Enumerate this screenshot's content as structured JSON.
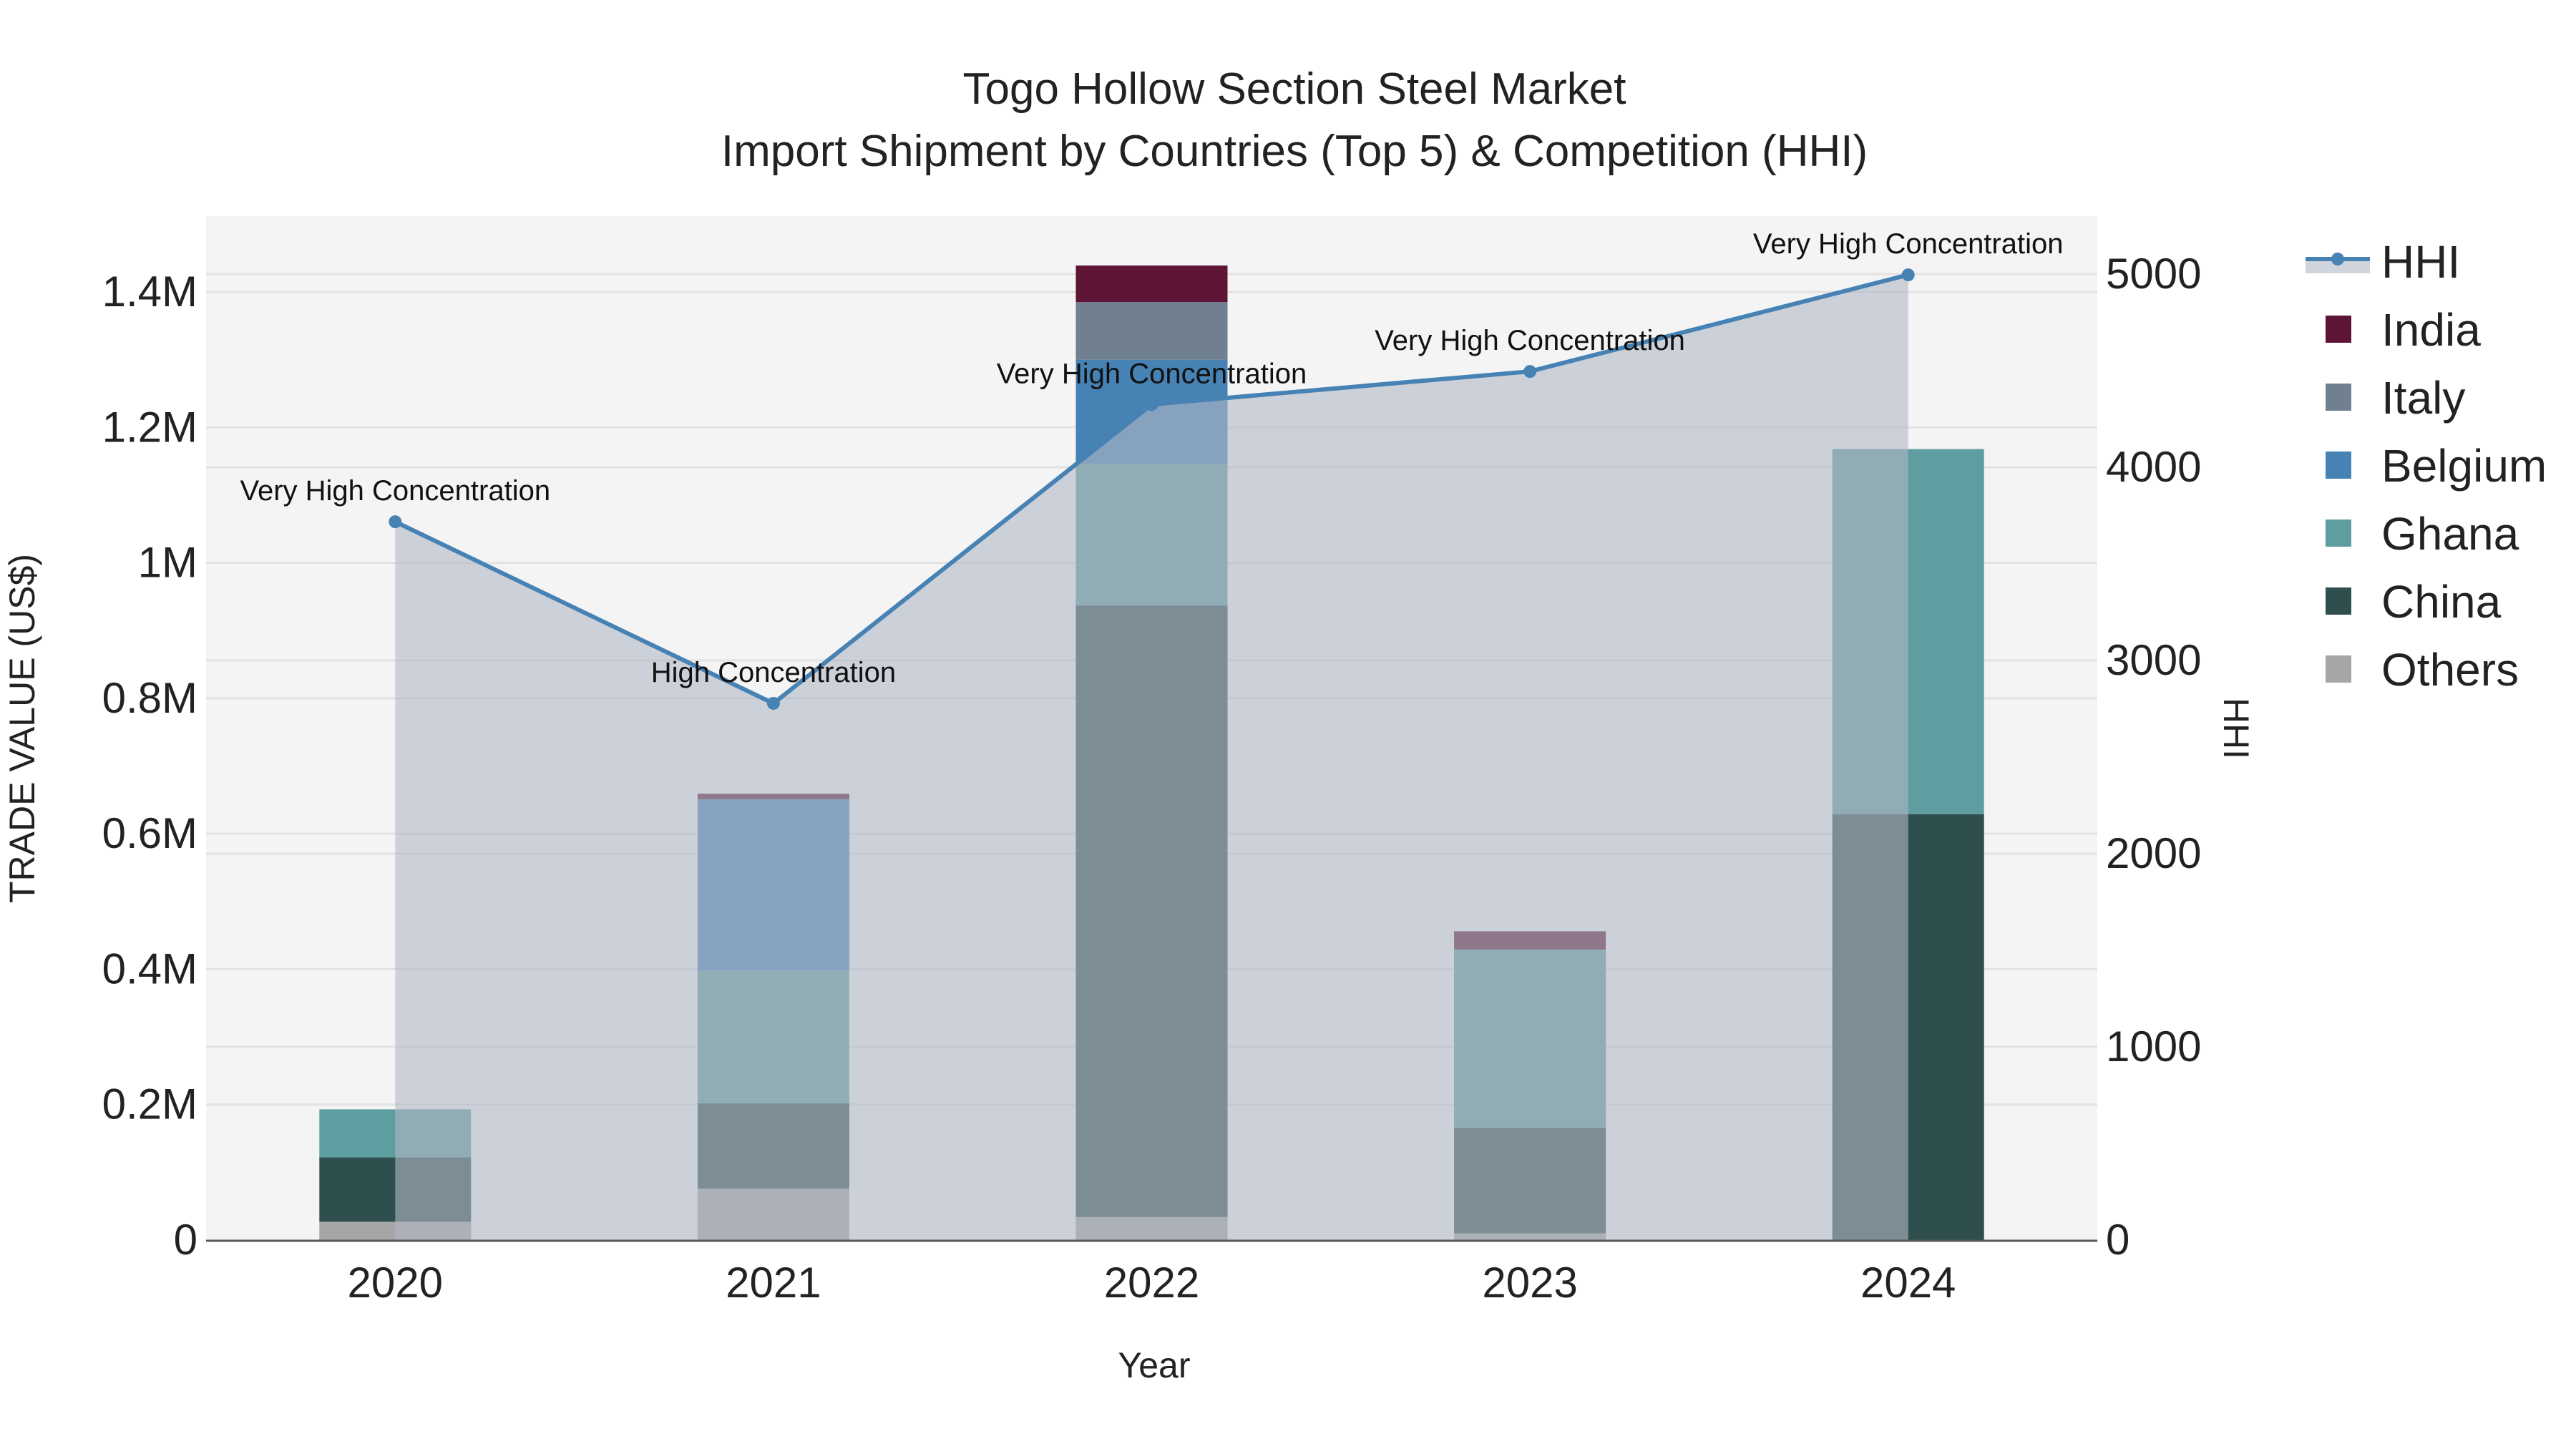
{
  "chart_data": {
    "type": "bar",
    "title": "Togo Hollow Section Steel Market",
    "subtitle": "Import Shipment by Countries (Top 5) & Competition (HHI)",
    "xlabel": "Year",
    "ylabel": "TRADE VALUE (US$)",
    "y2label": "HHI",
    "categories": [
      "2020",
      "2021",
      "2022",
      "2023",
      "2024"
    ],
    "ylim": [
      0,
      1512000
    ],
    "y2lim": [
      0,
      5300
    ],
    "yticks": [
      0,
      200000,
      400000,
      600000,
      800000,
      1000000,
      1200000,
      1400000
    ],
    "ytick_labels": [
      "0",
      "0.2M",
      "0.4M",
      "0.6M",
      "0.8M",
      "1M",
      "1.2M",
      "1.4M"
    ],
    "y2ticks": [
      0,
      1000,
      2000,
      3000,
      4000,
      5000
    ],
    "y2tick_labels": [
      "0",
      "1000",
      "2000",
      "3000",
      "4000",
      "5000"
    ],
    "grid": true,
    "legend_position": "right",
    "series": [
      {
        "name": "Others",
        "color": "#a6a6a6",
        "values": [
          27000,
          76000,
          34000,
          10000,
          0
        ]
      },
      {
        "name": "China",
        "color": "#2f4f4f",
        "values": [
          95000,
          126000,
          903000,
          156000,
          629000
        ]
      },
      {
        "name": "Ghana",
        "color": "#5f9ea0",
        "values": [
          71000,
          196000,
          209000,
          263000,
          539000
        ]
      },
      {
        "name": "Belgium",
        "color": "#4682b4",
        "values": [
          0,
          253000,
          154000,
          0,
          0
        ]
      },
      {
        "name": "Italy",
        "color": "#708090",
        "values": [
          0,
          0,
          85000,
          0,
          0
        ]
      },
      {
        "name": "India",
        "color": "#5e1535",
        "values": [
          0,
          8000,
          54000,
          27000,
          0
        ]
      }
    ],
    "hhi": {
      "name": "HHI",
      "color": "#4682b4",
      "values": [
        3718,
        2778,
        4325,
        4496,
        4996
      ],
      "annotations": [
        "Very High Concentration",
        "High Concentration",
        "Very High Concentration",
        "Very High Concentration",
        "Very High Concentration"
      ]
    },
    "legend_order": [
      "HHI",
      "India",
      "Italy",
      "Belgium",
      "Ghana",
      "China",
      "Others"
    ]
  }
}
